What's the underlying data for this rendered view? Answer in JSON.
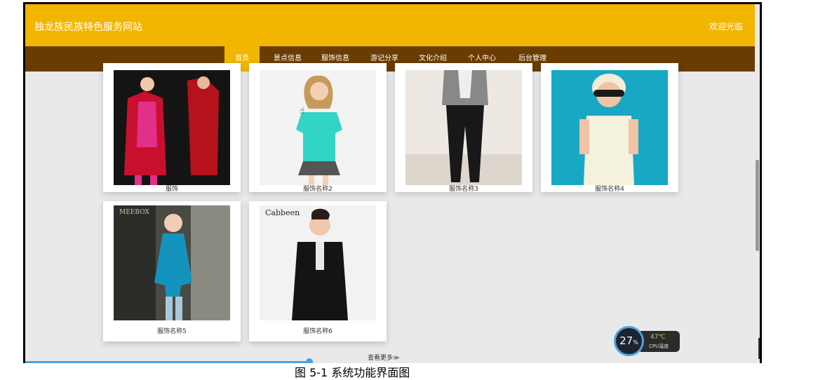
{
  "header": {
    "site_title": "独龙族民族特色服务网站",
    "welcome": "欢迎光临"
  },
  "nav": {
    "items": [
      {
        "label": "首页",
        "active": true
      },
      {
        "label": "景点信息"
      },
      {
        "label": "服饰信息"
      },
      {
        "label": "游记分享"
      },
      {
        "label": "文化介绍"
      },
      {
        "label": "个人中心"
      },
      {
        "label": "后台管理"
      }
    ]
  },
  "products": [
    {
      "name": "服饰"
    },
    {
      "name": "服饰名称2"
    },
    {
      "name": "服饰名称3"
    },
    {
      "name": "服饰名称4"
    },
    {
      "name": "服饰名称5"
    },
    {
      "name": "服饰名称6"
    }
  ],
  "photo_text": {
    "brand": "Cabbeen",
    "store_sign": "MEEBOX"
  },
  "more_label": "查看更多≫",
  "cpu": {
    "percent": "27",
    "unit": "%",
    "temperature": "47℃",
    "label": "CPU温度"
  },
  "caption_below": "图 5-1 系统功能界面图",
  "colors": {
    "header": "#f2b500",
    "nav": "#6b3c02",
    "active_nav": "#f2b500"
  },
  "icons": {
    "cursor": "hand-pointer-icon",
    "temp_drop": "green-drop-icon"
  }
}
